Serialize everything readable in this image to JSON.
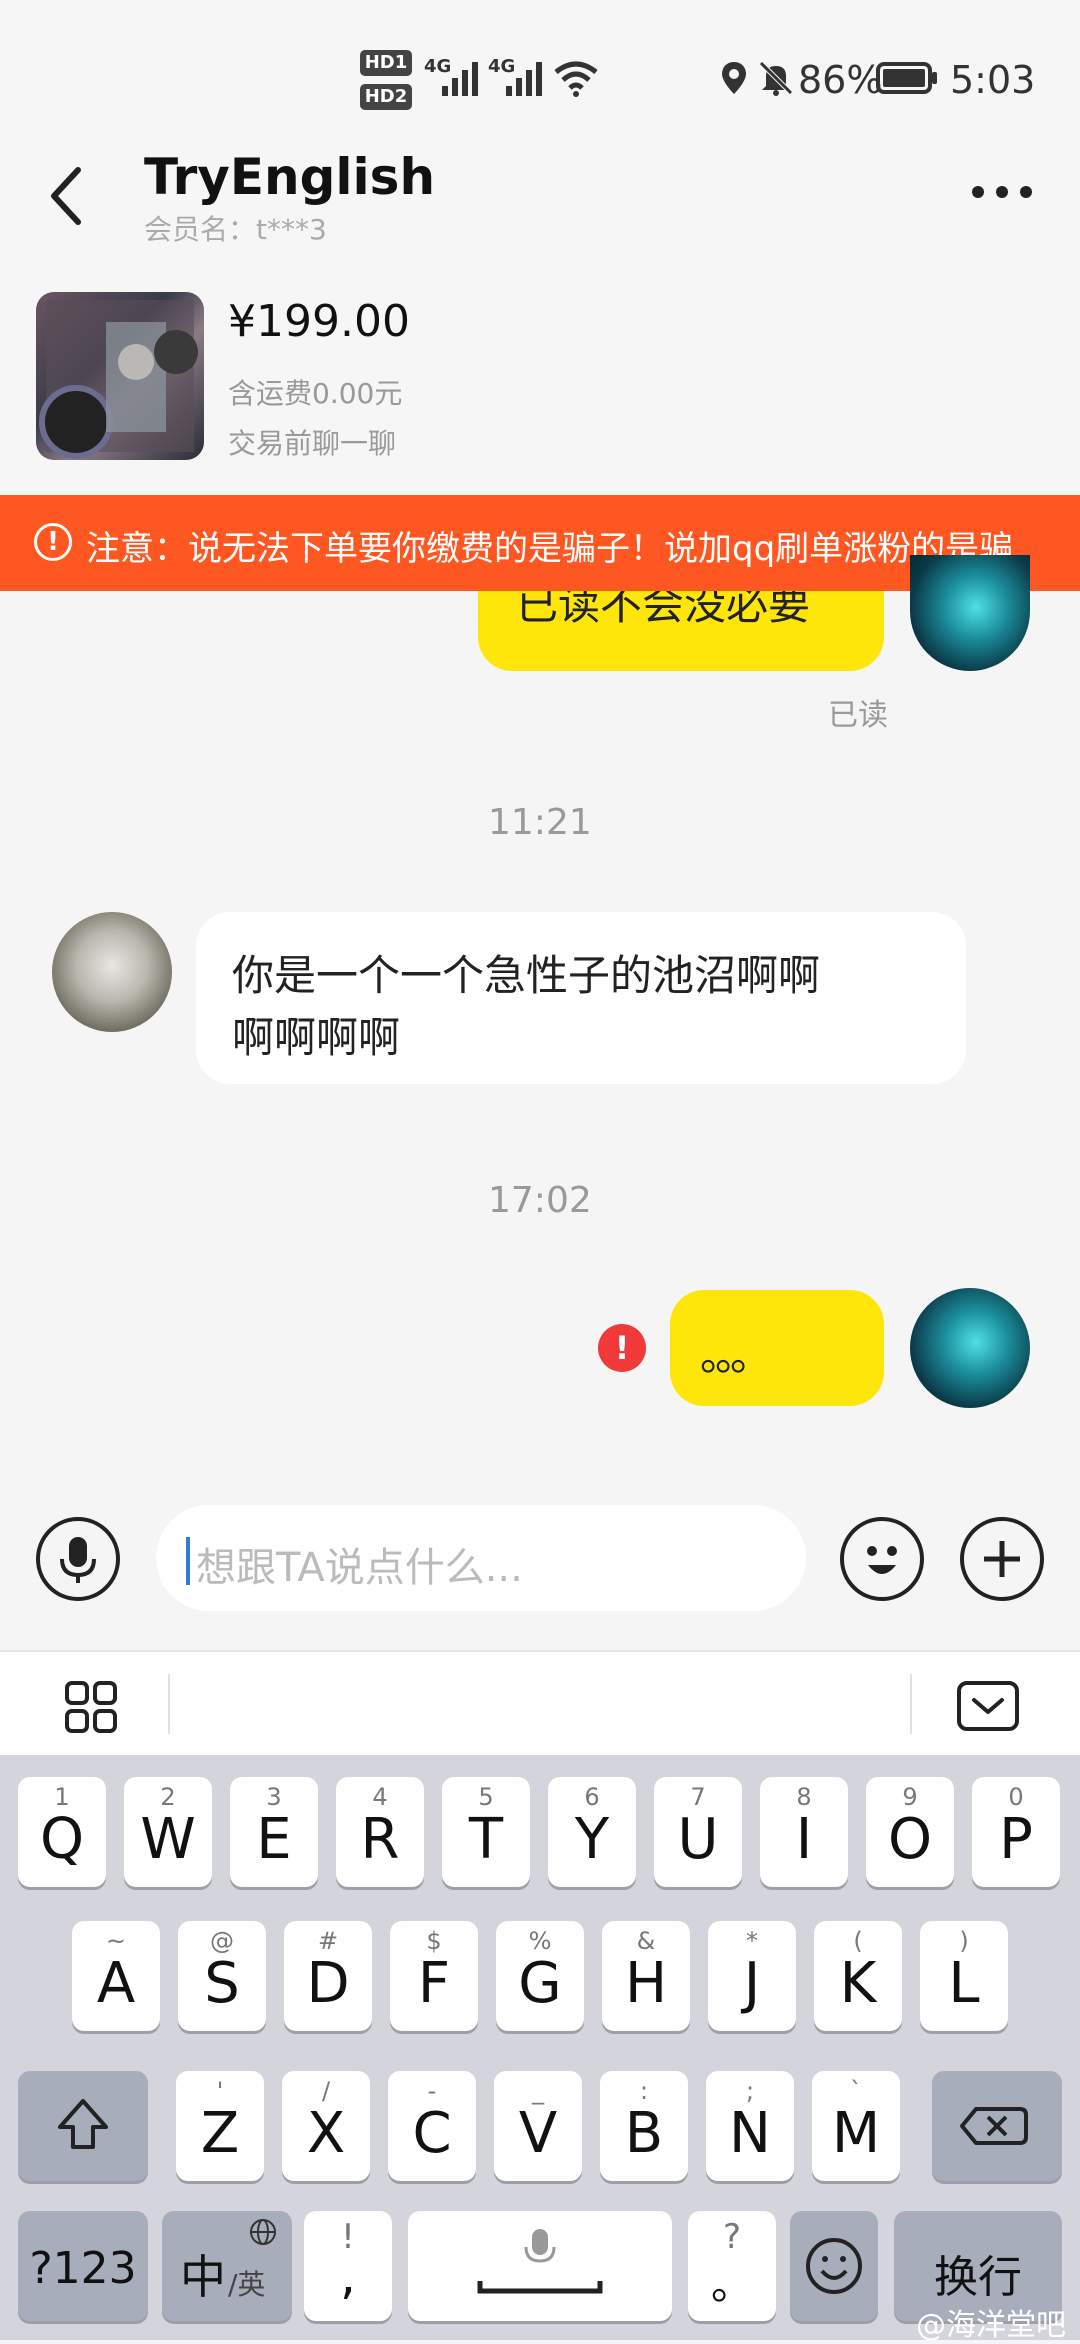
{
  "status_bar": {
    "hd1": "HD1",
    "hd2": "HD2",
    "net1": "4G",
    "net2": "4G",
    "battery": "86%",
    "time": "5:03",
    "icons": [
      "signal-icon",
      "wifi-icon",
      "location-icon",
      "mute-icon",
      "battery-icon"
    ]
  },
  "header": {
    "title": "TryEnglish",
    "member": "会员名：t***3"
  },
  "product": {
    "price": "¥199.00",
    "shipping": "含运费0.00元",
    "chat": "交易前聊一聊"
  },
  "warning": {
    "text": "注意：说无法下单要你缴费的是骗子！说加qq刷单涨粉的是骗"
  },
  "messages": {
    "m1_text": "已读不会没必要",
    "m1_status": "已读",
    "time1": "11:21",
    "m2_text_line1": "你是一个一个急性子的池沼啊啊",
    "m2_text_line2": "啊啊啊啊",
    "time2": "17:02",
    "m3_text": "。。。"
  },
  "input": {
    "placeholder": "想跟TA说点什么..."
  },
  "keyboard": {
    "row1": [
      {
        "h": "1",
        "k": "Q"
      },
      {
        "h": "2",
        "k": "W"
      },
      {
        "h": "3",
        "k": "E"
      },
      {
        "h": "4",
        "k": "R"
      },
      {
        "h": "5",
        "k": "T"
      },
      {
        "h": "6",
        "k": "Y"
      },
      {
        "h": "7",
        "k": "U"
      },
      {
        "h": "8",
        "k": "I"
      },
      {
        "h": "9",
        "k": "O"
      },
      {
        "h": "0",
        "k": "P"
      }
    ],
    "row2": [
      {
        "h": "~",
        "k": "A"
      },
      {
        "h": "@",
        "k": "S"
      },
      {
        "h": "#",
        "k": "D"
      },
      {
        "h": "$",
        "k": "F"
      },
      {
        "h": "%",
        "k": "G"
      },
      {
        "h": "&",
        "k": "H"
      },
      {
        "h": "*",
        "k": "J"
      },
      {
        "h": "(",
        "k": "K"
      },
      {
        "h": ")",
        "k": "L"
      }
    ],
    "row3": [
      {
        "h": "'",
        "k": "Z"
      },
      {
        "h": "/",
        "k": "X"
      },
      {
        "h": "-",
        "k": "C"
      },
      {
        "h": "_",
        "k": "V"
      },
      {
        "h": ":",
        "k": "B"
      },
      {
        "h": ";",
        "k": "N"
      },
      {
        "h": "`",
        "k": "M"
      }
    ],
    "num_key": "?123",
    "lang_key_main": "中",
    "lang_key_sub": "/英",
    "punct_hint": "!",
    "punct_main": ",",
    "q_hint": "?",
    "q_main": "。",
    "enter_key": "换行"
  },
  "watermark": "@海洋堂吧"
}
